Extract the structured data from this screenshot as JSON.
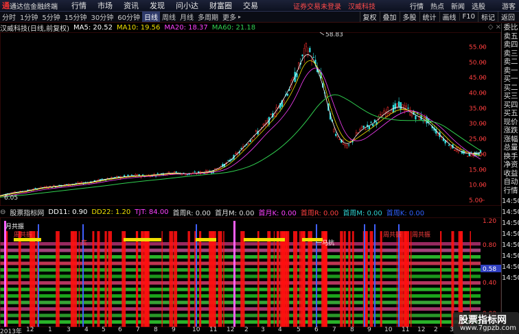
{
  "app": {
    "logo": "通",
    "title": "通达信金融终端"
  },
  "menu": [
    "行情",
    "市场",
    "资讯",
    "发现",
    "问小达",
    "财富圈",
    "交易"
  ],
  "menu_status": {
    "login": "证券交易未登录",
    "stock": "汉威科技"
  },
  "menu_right": [
    "行情",
    "热点",
    "新闻",
    "选股",
    "游客"
  ],
  "periods": [
    "分时",
    "1分钟",
    "5分钟",
    "15分钟",
    "30分钟",
    "60分钟",
    "日线",
    "周线",
    "月线",
    "多周期",
    "更多"
  ],
  "active_period": "日线",
  "tools": [
    "复权",
    "叠加",
    "多股",
    "统计",
    "画线",
    "F10",
    "标记",
    "返回"
  ],
  "header": {
    "stock_label": "汉威科技(日线,前复权)",
    "ma5": "MA5: 20.52",
    "ma10": "MA10: 19.56",
    "ma20": "MA20: 18.37",
    "ma60": "MA60: 21.18"
  },
  "indicator": {
    "name": "股票指标网",
    "dd11": "DD11: 0.90",
    "dd22": "DD22: 1.20",
    "tjt": "TJT: 84.00",
    "r_weekly": "首周R: 0.00",
    "m_month": "首月M: 0.00",
    "k_month": "首月K: 0.00",
    "r_week": "首周R: 0.00",
    "m_week": "首周M: 0.00",
    "k_week": "首周K: 0.00"
  },
  "indicator_labels": {
    "month_gong": "月共振",
    "week_gong1": "周共振",
    "week_gong2": "周共振",
    "week_gong3": "周共振",
    "di": "底",
    "kang": "一马抗"
  },
  "price_axis": [
    "55.00",
    "50.00",
    "45.00",
    "40.00",
    "35.00",
    "30.00",
    "25.00",
    "20.00",
    "15.00",
    "10.00",
    "5.00"
  ],
  "ind_axis": {
    "a": "1.20",
    "b": "0.80",
    "c": "0.58",
    "d": "0.40",
    "e": "0.00"
  },
  "annotations": {
    "high": "58.83",
    "low": "6.05"
  },
  "dates": [
    "2013年",
    "12",
    "1",
    "3",
    "4",
    "5",
    "6",
    "7",
    "8",
    "9",
    "10",
    "11",
    "12",
    "2",
    "3",
    "4",
    "5",
    "6",
    "7",
    "8",
    "9",
    "10",
    "11",
    "12",
    "2",
    "3",
    "4",
    "5",
    "6"
  ],
  "sidebar": [
    "委比",
    "卖五",
    "卖四",
    "卖三",
    "卖二",
    "卖一",
    "买一",
    "买二",
    "买三",
    "买四",
    "买五",
    "现价",
    "涨跌",
    "涨幅",
    "总量",
    "换手",
    "净资",
    "收益",
    "自动",
    "行情"
  ],
  "side_times": [
    "14:50",
    "14:50",
    "14:50",
    "14:50",
    "14:50",
    "14:50",
    "14:50",
    "14:50"
  ],
  "watermark": {
    "title": "股票指标网",
    "url": "www.7gpzb.com"
  },
  "colors": {
    "ma5": "#ffffff",
    "ma10": "#f0e000",
    "ma20": "#ff40ff",
    "ma60": "#30d050",
    "up": "#ff3030",
    "down": "#30e0e0",
    "accent": "#ff4b4b"
  },
  "chart_data": {
    "type": "line",
    "ylim": [
      5,
      58
    ],
    "series": [
      {
        "name": "MA5",
        "values": [
          6.5,
          7.5,
          8,
          9,
          9.5,
          10,
          10.5,
          11,
          12,
          12.5,
          13,
          13,
          13.5,
          14,
          13.5,
          14,
          14.5,
          17,
          21,
          26,
          30,
          36,
          44,
          55,
          46,
          28,
          22,
          28,
          30,
          34,
          36,
          33,
          31,
          26,
          22,
          20,
          20.5
        ]
      },
      {
        "name": "MA10",
        "values": [
          6.3,
          7.2,
          7.8,
          8.8,
          9.3,
          9.8,
          10.3,
          10.8,
          11.7,
          12.3,
          12.8,
          13,
          13.3,
          13.8,
          13.6,
          13.9,
          14.3,
          16,
          20,
          24.5,
          29,
          34,
          41,
          52,
          48,
          31,
          23,
          26,
          29,
          32.5,
          35,
          34,
          31.5,
          27.5,
          23,
          20.5,
          19.6
        ]
      },
      {
        "name": "MA20",
        "values": [
          6,
          6.8,
          7.4,
          8.3,
          8.9,
          9.4,
          9.9,
          10.4,
          11.2,
          11.9,
          12.4,
          12.8,
          13,
          13.5,
          13.6,
          13.8,
          14.1,
          15,
          18,
          22,
          27,
          31,
          37,
          47,
          49,
          36,
          25,
          24,
          27,
          30.5,
          33.5,
          34.5,
          32,
          29,
          24.5,
          21,
          18.4
        ]
      },
      {
        "name": "MA60",
        "values": [
          6,
          6.4,
          6.8,
          7.3,
          7.8,
          8.3,
          8.8,
          9.3,
          9.8,
          10.4,
          10.9,
          11.4,
          11.8,
          12.3,
          12.8,
          13.2,
          13.6,
          14,
          15,
          16.5,
          19,
          22,
          26,
          31,
          37,
          40,
          38,
          35,
          32.5,
          31.5,
          31,
          31,
          31,
          30,
          27,
          24,
          21.2
        ]
      }
    ]
  }
}
